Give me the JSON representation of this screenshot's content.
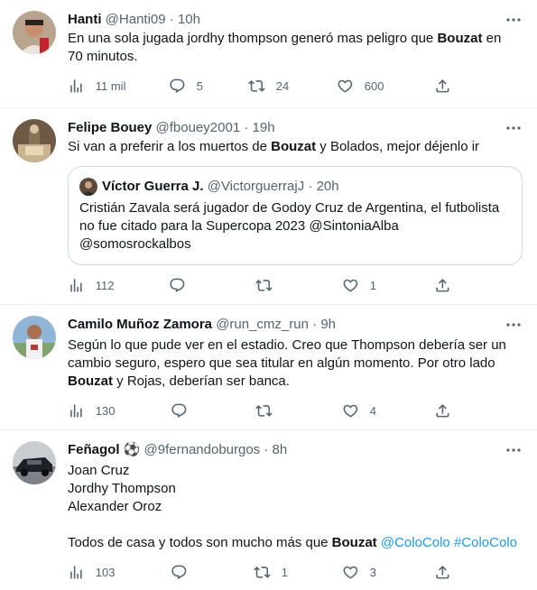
{
  "tweets": [
    {
      "name": "Hanti",
      "handle": "@Hanti09",
      "dot": "·",
      "time": "10h",
      "text_parts": [
        "En una sola jugada jordhy thompson generó mas peligro que ",
        "Bouzat",
        " en 70 minutos."
      ],
      "views": "11 mil",
      "replies": "5",
      "retweets": "24",
      "likes": "600"
    },
    {
      "name": "Felipe Bouey",
      "handle": "@fbouey2001",
      "dot": "·",
      "time": "19h",
      "text_parts": [
        "Si van a preferir a los muertos de ",
        "Bouzat",
        " y Bolados, mejor déjenlo ir"
      ],
      "quote": {
        "name": "Víctor Guerra J.",
        "handle": "@VictorguerrajJ",
        "dot": "·",
        "time": "20h",
        "text": "Cristián Zavala será jugador de Godoy Cruz de Argentina, el futbolista no fue citado para la Supercopa 2023 @SintoniaAlba @somosrockalbos"
      },
      "views": "112",
      "replies": "",
      "retweets": "",
      "likes": "1"
    },
    {
      "name": "Camilo Muñoz Zamora",
      "handle": "@run_cmz_run",
      "dot": "·",
      "time": "9h",
      "text_parts": [
        "Según lo que pude ver en el estadio. Creo que Thompson debería ser un cambio seguro, espero que sea titular en algún momento. Por otro lado ",
        "Bouzat",
        " y Rojas, deberían ser banca."
      ],
      "views": "130",
      "replies": "",
      "retweets": "",
      "likes": "4"
    },
    {
      "name": "Feñagol ⚽",
      "handle": "@9fernandoburgos",
      "dot": "·",
      "time": "8h",
      "lines": [
        "Joan Cruz",
        "Jordhy Thompson",
        "Alexander Oroz"
      ],
      "closing_parts": [
        "Todos de casa y todos son mucho más que ",
        "Bouzat",
        " ",
        "@ColoColo",
        " ",
        "#ColoColo"
      ],
      "views": "103",
      "replies": "",
      "retweets": "1",
      "likes": "3"
    }
  ],
  "colors": {
    "text": "#0f1419",
    "secondary": "#536471",
    "link": "#1d9bf0",
    "divider": "#eff3f4",
    "quote_border": "#cfd9de"
  },
  "icons": [
    "views-icon",
    "reply-icon",
    "retweet-icon",
    "like-icon",
    "share-icon",
    "more-icon"
  ]
}
